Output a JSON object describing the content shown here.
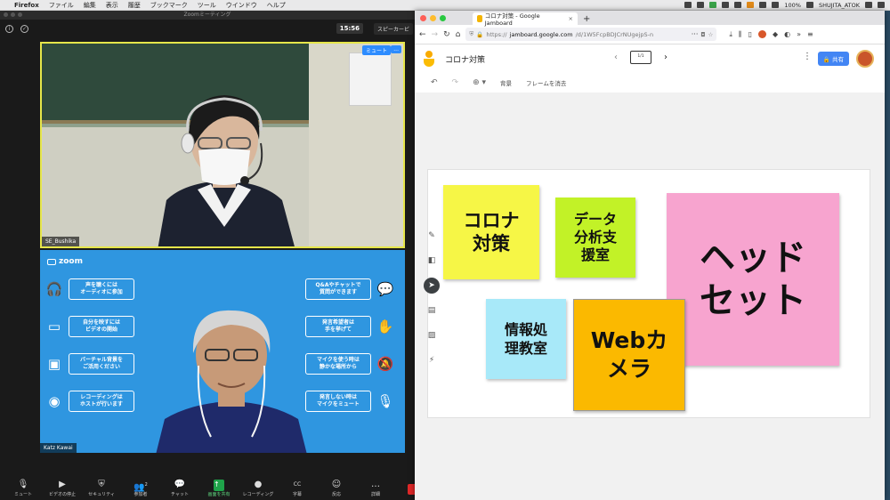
{
  "menubar": {
    "app": "Firefox",
    "items": [
      "ファイル",
      "編集",
      "表示",
      "履歴",
      "ブックマーク",
      "ツール",
      "ウインドウ",
      "ヘルプ"
    ],
    "battery": "100%",
    "user": "SHUJITA_ATOK"
  },
  "zoom": {
    "window_title": "Zoomミーティング",
    "time": "15:56",
    "speaker_view": "スピーカービ",
    "tile1": {
      "name": "SE_Bushika",
      "mute_label": "ミュート",
      "more_label": "..."
    },
    "tile2": {
      "name": "Katz Kawai",
      "logo": "zoom",
      "tips_left": [
        {
          "text": "声を聴くには\nオーディオに参加",
          "icon": "headphones-icon"
        },
        {
          "text": "自分を映すには\nビデオの開始",
          "icon": "video-off-icon"
        },
        {
          "text": "バーチャル背景を\nご活用ください",
          "icon": "image-icon"
        },
        {
          "text": "レコーディングは\nホストが行います",
          "icon": "record-icon"
        }
      ],
      "tips_right": [
        {
          "text": "Q&Aやチャットで\n質問ができます",
          "icon": "chat-icon"
        },
        {
          "text": "発言希望者は\n手を挙げて",
          "icon": "raise-hand-icon"
        },
        {
          "text": "マイクを使う時は\n静かな場所から",
          "icon": "mute-bell-icon"
        },
        {
          "text": "発言しない時は\nマイクをミュート",
          "icon": "mic-off-icon"
        }
      ]
    },
    "toolbar": [
      {
        "label": "ミュート",
        "glyph": "🎙",
        "name": "mute-button"
      },
      {
        "label": "ビデオの停止",
        "glyph": "▶",
        "name": "stop-video-button"
      },
      {
        "label": "セキュリティ",
        "glyph": "⛨",
        "name": "security-button"
      },
      {
        "label": "参加者",
        "glyph": "👥",
        "name": "participants-button"
      },
      {
        "label": "チャット",
        "glyph": "💬",
        "name": "chat-button"
      },
      {
        "label": "画面を共有",
        "glyph": "↑",
        "name": "share-screen-button"
      },
      {
        "label": "レコーディング",
        "glyph": "●",
        "name": "record-button"
      },
      {
        "label": "字幕",
        "glyph": "CC",
        "name": "captions-button"
      },
      {
        "label": "反応",
        "glyph": "☺",
        "name": "reactions-button"
      },
      {
        "label": "詳細",
        "glyph": "…",
        "name": "more-button"
      }
    ],
    "participants_count": "2"
  },
  "firefox": {
    "tab_title": "コロナ対策 - Google Jamboard",
    "url_prefix": "https://",
    "url_domain": "jamboard.google.com",
    "url_rest": "/d/1W5FcpBDJCrNUgejpS-n"
  },
  "jamboard": {
    "title": "コロナ対策",
    "frame_counter": "1/1",
    "share_label": "共有",
    "tools": {
      "background": "背景",
      "clear_frame": "フレームを消去"
    },
    "notes": [
      {
        "text": "コロナ\n対策",
        "color": "#f6f646"
      },
      {
        "text": "データ\n分析支\n援室",
        "color": "#c2f227"
      },
      {
        "text": "ヘッド\nセット",
        "color": "#f7a4cf"
      },
      {
        "text": "情報処\n理教室",
        "color": "#a8e9f9"
      },
      {
        "text": "Webカ\nメラ",
        "color": "#fbb900"
      }
    ]
  }
}
